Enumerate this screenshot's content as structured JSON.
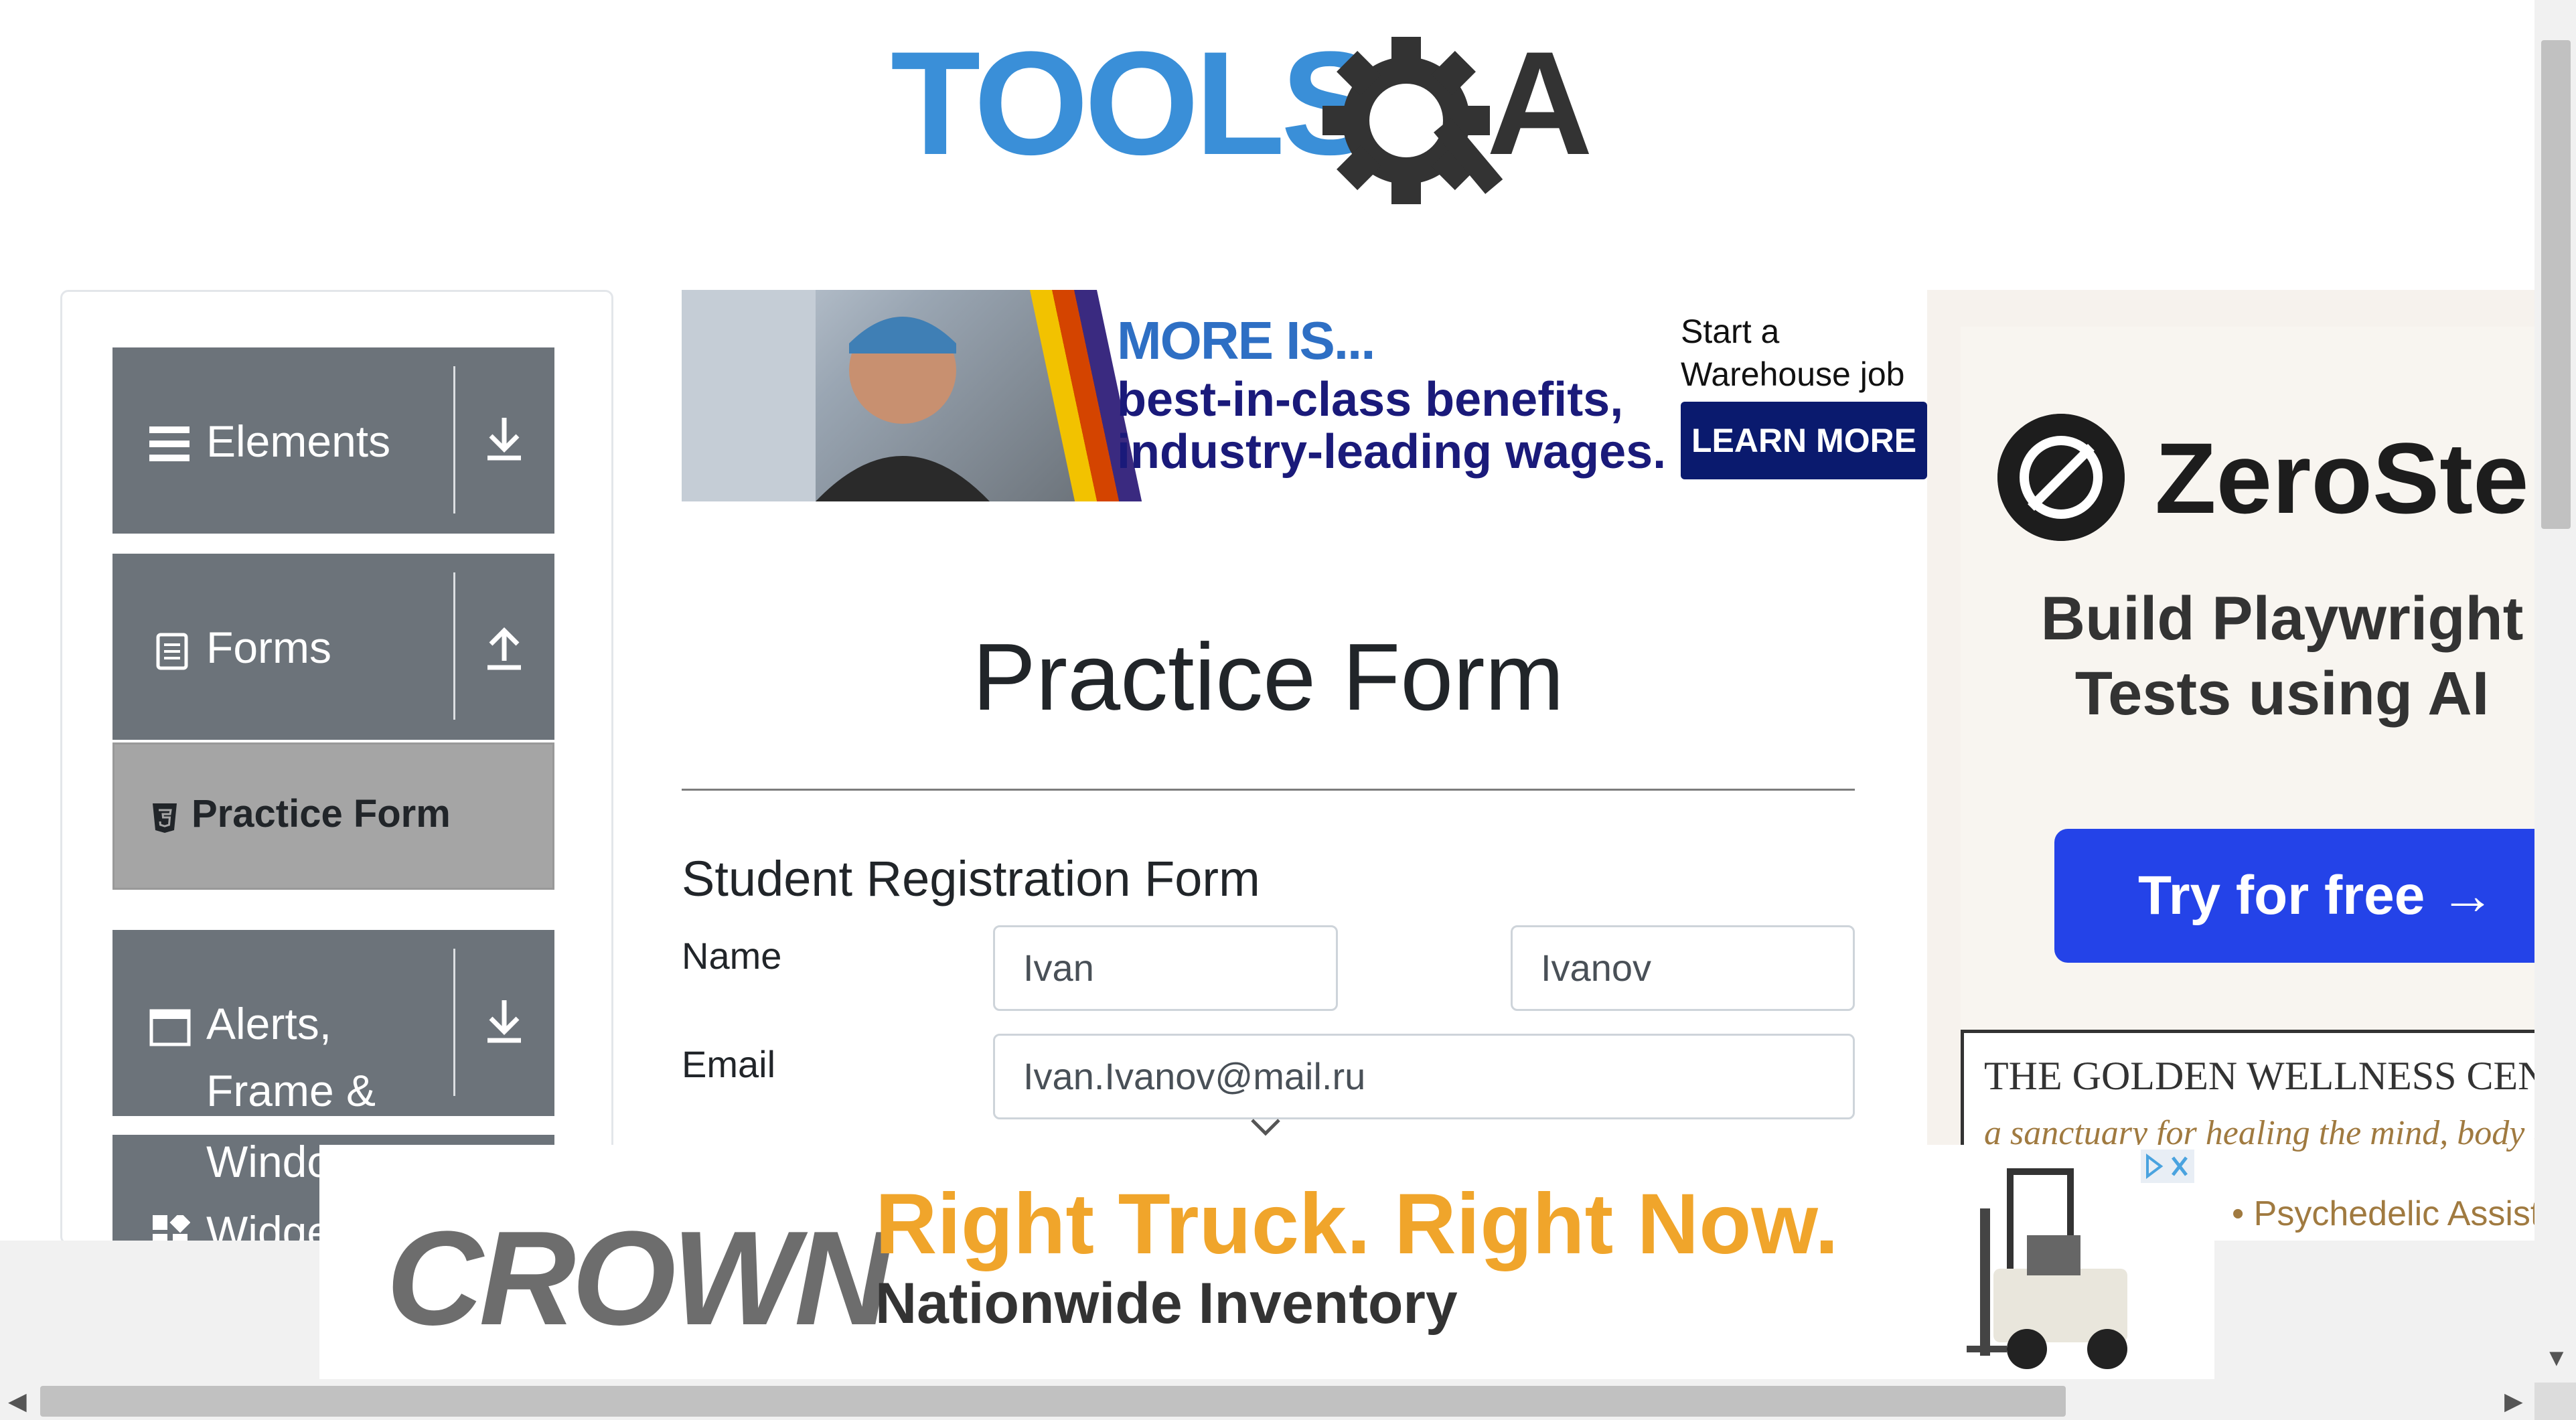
{
  "logo": {
    "text_left": "TOOLS",
    "text_right": "QA"
  },
  "sidebar": {
    "groups": [
      {
        "label": "Elements"
      },
      {
        "label": "Forms"
      },
      {
        "label": "Alerts, Frame & Windows",
        "label_lines": [
          "Alerts,",
          "Frame &",
          "Windo"
        ]
      },
      {
        "label": "Widgets",
        "label_partial": "Widge"
      }
    ],
    "active_item": {
      "label": "Practice Form"
    }
  },
  "top_ad": {
    "headline": "MORE IS...",
    "benefits_line1": "best-in-class benefits,",
    "benefits_line2": "industry-leading wages.",
    "cta_text": "Start a Warehouse job with great pay.",
    "cta_button": "LEARN MORE"
  },
  "main": {
    "page_title": "Practice Form",
    "form_heading": "Student Registration Form",
    "name_label": "Name",
    "first_name_value": "Ivan",
    "last_name_value": "Ivanov",
    "email_label": "Email",
    "email_value": "Ivan.Ivanov@mail.ru"
  },
  "right_ad": {
    "brand": "ZeroStep",
    "subline1": "Build Playwright",
    "subline2": "Tests using AI",
    "button": "Try for free →",
    "second_ad_title": "THE GOLDEN WELLNESS CENTER",
    "second_ad_tagline": "a sanctuary for healing the mind, body and",
    "second_ad_bullet": "• Psychedelic Assisted"
  },
  "bottom_ad": {
    "brand": "CROWN",
    "headline": "Right Truck. Right Now.",
    "subline": "Nationwide Inventory"
  },
  "colors": {
    "sidebar_group": "#6c737a",
    "sidebar_active": "#a5a5a5",
    "logo_blue": "#3a8fd8",
    "logo_dark": "#333333",
    "ad_cta_navy": "#0a1a6e",
    "zerostep_button": "#2443e8",
    "crown_orange": "#f0a52b"
  },
  "icons": [
    "hamburger-icon",
    "download-icon",
    "form-list-icon",
    "upload-icon",
    "html5-badge-icon",
    "window-icon",
    "widgets-icon",
    "chevron-down-icon",
    "ad-choices-icon",
    "close-icon",
    "scroll-left-icon",
    "scroll-right-icon",
    "scroll-down-icon"
  ]
}
